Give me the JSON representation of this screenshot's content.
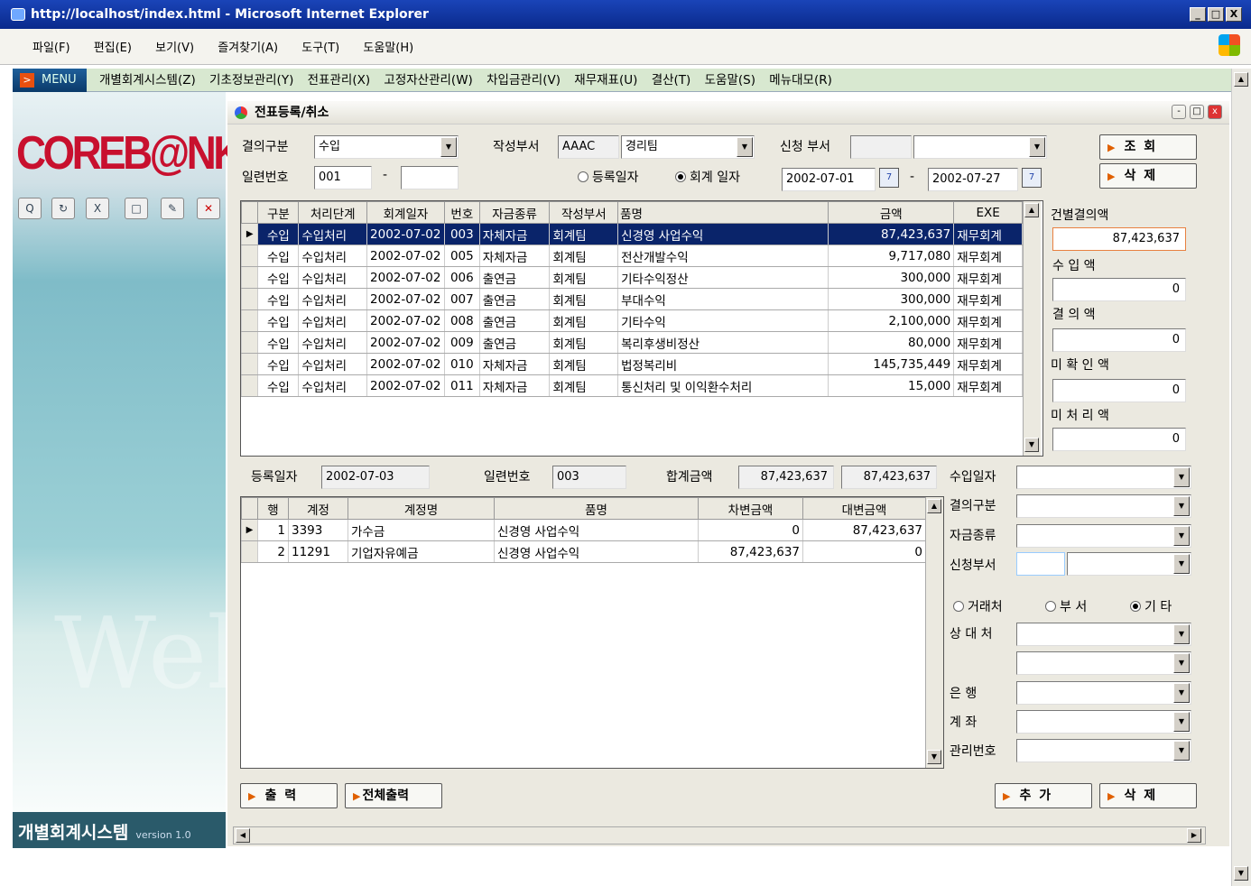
{
  "window": {
    "title": "http://localhost/index.html - Microsoft Internet Explorer",
    "min": "_",
    "max": "□",
    "close": "X"
  },
  "browser_menu": [
    "파일(F)",
    "편집(E)",
    "보기(V)",
    "즐겨찾기(A)",
    "도구(T)",
    "도움말(H)"
  ],
  "app_menu": {
    "tag": "MENU",
    "items": [
      "개별회계시스템(Z)",
      "기초정보관리(Y)",
      "전표관리(X)",
      "고정자산관리(W)",
      "차입금관리(V)",
      "재무재표(U)",
      "결산(T)",
      "도움말(S)",
      "메뉴대모(R)"
    ]
  },
  "sidebar": {
    "logo": "COREB@NK",
    "system_name": "개별회계시스템",
    "version": "version 1.0",
    "watermark": "Wel"
  },
  "form": {
    "title": "전표등록/취소",
    "resolution_type_label": "결의구분",
    "resolution_type_value": "수입",
    "writer_dept_label": "작성부서",
    "writer_dept_code": "AAAC",
    "writer_dept_name": "경리팀",
    "request_dept_label": "신청 부서",
    "request_dept_code": "",
    "request_dept_name": "",
    "serial_label": "일련번호",
    "serial_from": "001",
    "serial_dash": "-",
    "serial_to": "",
    "reg_date_radio": "등록일자",
    "acc_date_radio": "회계 일자",
    "date_from": "2002-07-01",
    "date_dash": "-",
    "date_to": "2002-07-27",
    "search_button": "조 회",
    "delete_button": "삭 제"
  },
  "list": {
    "columns": [
      "구분",
      "처리단계",
      "회계일자",
      "번호",
      "자금종류",
      "작성부서",
      "품명",
      "금액",
      "EXE"
    ],
    "rows": [
      [
        "수입",
        "수입처리",
        "2002-07-02",
        "003",
        "자체자금",
        "회계팀",
        "신경영 사업수익",
        "87,423,637",
        "재무회계"
      ],
      [
        "수입",
        "수입처리",
        "2002-07-02",
        "005",
        "자체자금",
        "회계팀",
        "전산개발수익",
        "9,717,080",
        "재무회계"
      ],
      [
        "수입",
        "수입처리",
        "2002-07-02",
        "006",
        "출연금",
        "회계팀",
        "기타수익정산",
        "300,000",
        "재무회계"
      ],
      [
        "수입",
        "수입처리",
        "2002-07-02",
        "007",
        "출연금",
        "회계팀",
        "부대수익",
        "300,000",
        "재무회계"
      ],
      [
        "수입",
        "수입처리",
        "2002-07-02",
        "008",
        "출연금",
        "회계팀",
        "기타수익",
        "2,100,000",
        "재무회계"
      ],
      [
        "수입",
        "수입처리",
        "2002-07-02",
        "009",
        "출연금",
        "회계팀",
        "복리후생비정산",
        "80,000",
        "재무회계"
      ],
      [
        "수입",
        "수입처리",
        "2002-07-02",
        "010",
        "자체자금",
        "회계팀",
        "법정복리비",
        "145,735,449",
        "재무회계"
      ],
      [
        "수입",
        "수입처리",
        "2002-07-02",
        "011",
        "자체자금",
        "회계팀",
        "통신처리 및 이익환수처리",
        "15,000",
        "재무회계"
      ]
    ]
  },
  "summary": {
    "per_item_label": "건별결의액",
    "per_item_value": "87,423,637",
    "income_label": "수 입 액",
    "income_value": "0",
    "resolution_label": "결 의 액",
    "resolution_value": "0",
    "unconfirmed_label": "미 확 인 액",
    "unconfirmed_value": "0",
    "unprocessed_label": "미 처 리 액",
    "unprocessed_value": "0"
  },
  "detail": {
    "reg_date_label": "등록일자",
    "reg_date": "2002-07-03",
    "serial_label": "일련번호",
    "serial": "003",
    "total_label": "합계금액",
    "total_debit": "87,423,637",
    "total_credit": "87,423,637",
    "columns": [
      "행",
      "계정",
      "계정명",
      "품명",
      "차변금액",
      "대변금액"
    ],
    "rows": [
      [
        "1",
        "3393",
        "가수금",
        "신경영 사업수익",
        "0",
        "87,423,637"
      ],
      [
        "2",
        "11291",
        "기업자유예금",
        "신경영 사업수익",
        "87,423,637",
        "0"
      ]
    ]
  },
  "right_panel": {
    "income_date": "수입일자",
    "resolution_type": "결의구분",
    "fund_type": "자금종류",
    "request_dept": "신청부서",
    "radio_client": "거래처",
    "radio_dept": "부 서",
    "radio_etc": "기 타",
    "counterpart": "상 대 처",
    "bank": "은   행",
    "account": "계   좌",
    "manage_no": "관리번호"
  },
  "bottom_buttons": {
    "print": "출 력",
    "print_all": "전체출력",
    "add": "추 가",
    "delete": "삭 제"
  }
}
